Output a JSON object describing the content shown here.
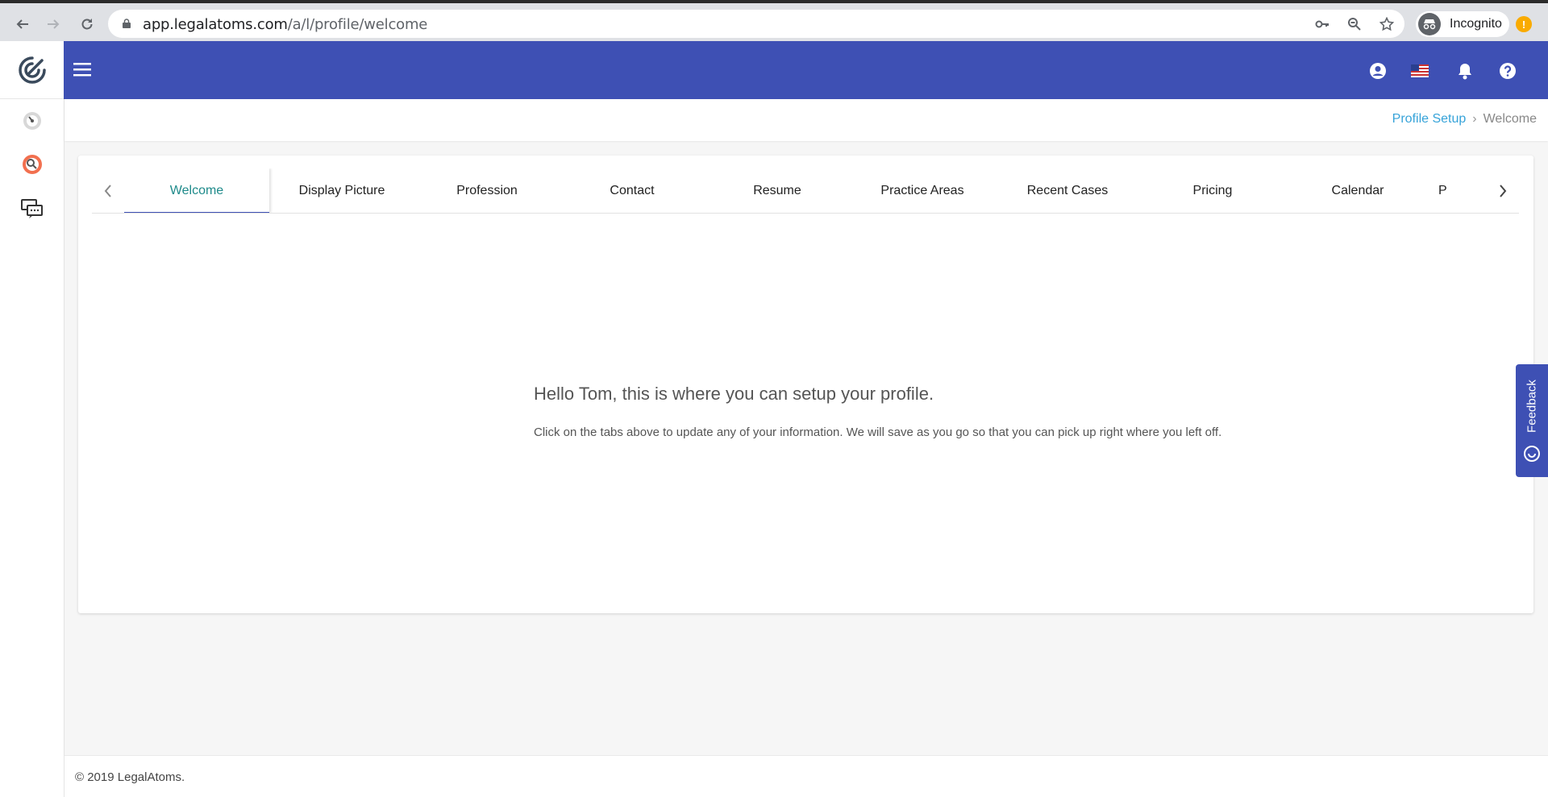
{
  "browser": {
    "url_host": "app.legalatoms.com",
    "url_path": "/a/l/profile/welcome",
    "incognito_label": "Incognito",
    "alert_badge": "!"
  },
  "sidebar": {
    "items": [
      {
        "name": "dashboard-icon"
      },
      {
        "name": "search-lawyer-icon"
      },
      {
        "name": "messages-icon"
      }
    ]
  },
  "header": {
    "icons": [
      "user-account-icon",
      "us-flag-icon",
      "bell-icon",
      "help-icon"
    ]
  },
  "breadcrumb": {
    "parent": "Profile Setup",
    "separator": "›",
    "current": "Welcome"
  },
  "tabs": [
    {
      "label": "Welcome",
      "active": true
    },
    {
      "label": "Display Picture"
    },
    {
      "label": "Profession"
    },
    {
      "label": "Contact"
    },
    {
      "label": "Resume"
    },
    {
      "label": "Practice Areas"
    },
    {
      "label": "Recent Cases"
    },
    {
      "label": "Pricing"
    },
    {
      "label": "Calendar"
    },
    {
      "label": "P"
    }
  ],
  "main": {
    "heading": "Hello Tom, this is where you can setup your profile.",
    "body": "Click on the tabs above to update any of your information. We will save as you go so that you can pick up right where you left off."
  },
  "feedback": {
    "label": "Feedback"
  },
  "footer": {
    "copyright": "© 2019 LegalAtoms."
  },
  "colors": {
    "primary": "#3e50b4",
    "link": "#36a3d9",
    "active_tab_text": "#1e8a8a"
  }
}
